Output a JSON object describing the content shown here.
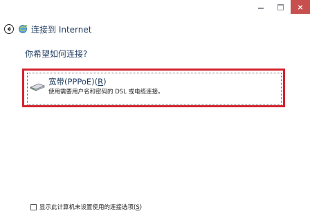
{
  "window": {
    "controls": {
      "minimize": "–",
      "maximize": "□",
      "close": "×"
    }
  },
  "nav": {
    "title": "连接到 Internet"
  },
  "question": "你希望如何连接?",
  "option": {
    "title": "宽带(PPPoE)(",
    "mnemonic": "R",
    "title_end": ")",
    "description": "使用需要用户名和密码的 DSL 或电缆连接。",
    "icon": "modem-icon"
  },
  "checkbox": {
    "label": "显示此计算机未设置使用的连接选项(",
    "mnemonic": "S",
    "label_end": ")",
    "checked": false
  },
  "colors": {
    "highlight": "#d2232e",
    "close_button": "#c7504f",
    "title_text": "#1e3a5f"
  }
}
